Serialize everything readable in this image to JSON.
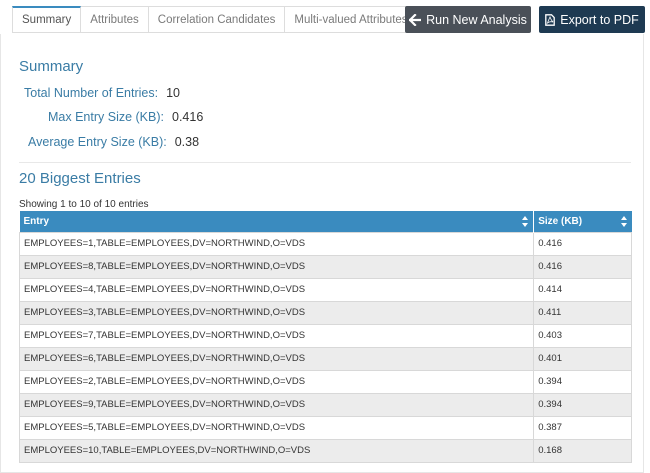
{
  "tabs": [
    {
      "label": "Summary",
      "active": true
    },
    {
      "label": "Attributes",
      "active": false
    },
    {
      "label": "Correlation Candidates",
      "active": false
    },
    {
      "label": "Multi-valued Attributes",
      "active": false
    }
  ],
  "buttons": {
    "run": {
      "label": "Run New Analysis",
      "icon": "arrow-left-icon",
      "color": "#4a5058"
    },
    "export": {
      "label": "Export to PDF",
      "icon": "pdf-file-icon",
      "color": "#1e3a52"
    }
  },
  "summary": {
    "title": "Summary",
    "total_label": "Total Number of Entries:",
    "total_value": "10",
    "max_label": "Max Entry Size (KB):",
    "max_value": "0.416",
    "avg_label": "Average Entry Size (KB):",
    "avg_value": "0.38"
  },
  "biggest": {
    "title": "20 Biggest Entries",
    "showing": "Showing 1 to 10 of 10 entries",
    "columns": [
      "Entry",
      "Size (KB)"
    ],
    "rows": [
      [
        "EMPLOYEES=1,TABLE=EMPLOYEES,DV=NORTHWIND,O=VDS",
        "0.416"
      ],
      [
        "EMPLOYEES=8,TABLE=EMPLOYEES,DV=NORTHWIND,O=VDS",
        "0.416"
      ],
      [
        "EMPLOYEES=4,TABLE=EMPLOYEES,DV=NORTHWIND,O=VDS",
        "0.414"
      ],
      [
        "EMPLOYEES=3,TABLE=EMPLOYEES,DV=NORTHWIND,O=VDS",
        "0.411"
      ],
      [
        "EMPLOYEES=7,TABLE=EMPLOYEES,DV=NORTHWIND,O=VDS",
        "0.403"
      ],
      [
        "EMPLOYEES=6,TABLE=EMPLOYEES,DV=NORTHWIND,O=VDS",
        "0.401"
      ],
      [
        "EMPLOYEES=2,TABLE=EMPLOYEES,DV=NORTHWIND,O=VDS",
        "0.394"
      ],
      [
        "EMPLOYEES=9,TABLE=EMPLOYEES,DV=NORTHWIND,O=VDS",
        "0.394"
      ],
      [
        "EMPLOYEES=5,TABLE=EMPLOYEES,DV=NORTHWIND,O=VDS",
        "0.387"
      ],
      [
        "EMPLOYEES=10,TABLE=EMPLOYEES,DV=NORTHWIND,O=VDS",
        "0.168"
      ]
    ]
  },
  "colors": {
    "accent": "#3a8bbf",
    "heading": "#3a7ca5",
    "row_alt": "#ececec"
  }
}
